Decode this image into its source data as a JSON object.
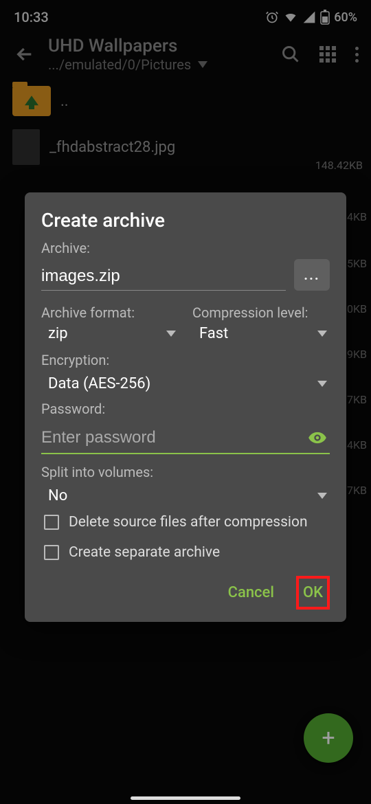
{
  "status": {
    "time": "10:33",
    "battery": "60%"
  },
  "appbar": {
    "title": "UHD Wallpapers",
    "path": ".../emulated/0/Pictures"
  },
  "files": {
    "up_label": "..",
    "items": [
      {
        "name": "_fhdabstract28.jpg",
        "size": "148.42KB"
      }
    ],
    "peek_sizes": [
      "4KB",
      "5KB",
      "0KB",
      "9KB",
      "7KB",
      "4KB",
      "7KB"
    ]
  },
  "dialog": {
    "title": "Create archive",
    "archive_label": "Archive:",
    "archive_value": "images.zip",
    "browse_label": "...",
    "format_label": "Archive format:",
    "format_value": "zip",
    "level_label": "Compression level:",
    "level_value": "Fast",
    "encryption_label": "Encryption:",
    "encryption_value": "Data (AES-256)",
    "password_label": "Password:",
    "password_placeholder": "Enter password",
    "split_label": "Split into volumes:",
    "split_value": "No",
    "delete_label": "Delete source files after compression",
    "separate_label": "Create separate archive",
    "cancel": "Cancel",
    "ok": "OK"
  },
  "fab": {
    "plus": "+"
  }
}
